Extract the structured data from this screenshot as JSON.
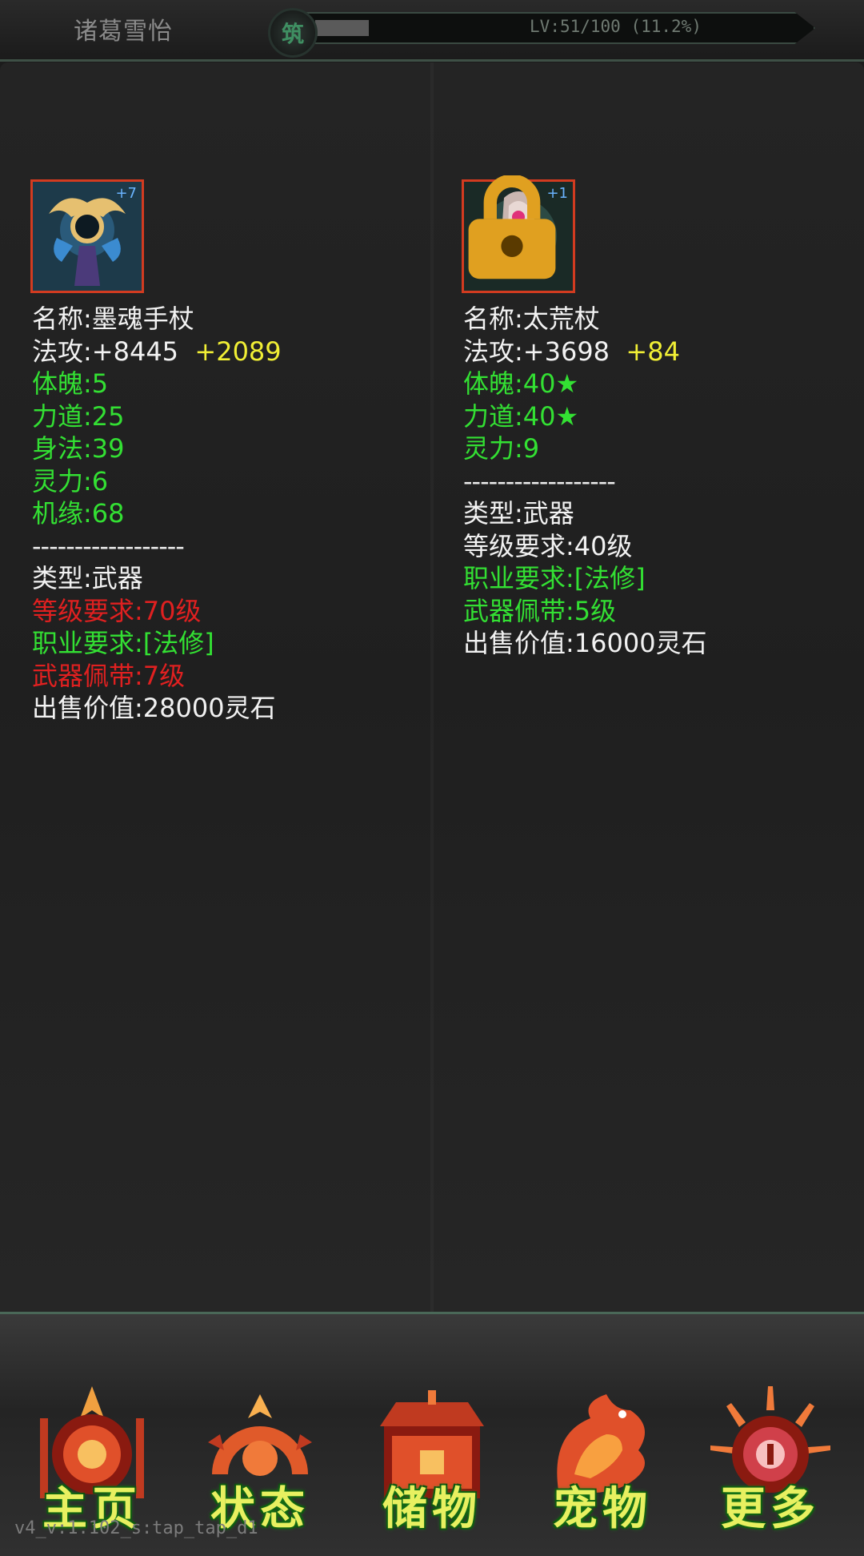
{
  "header": {
    "character_name": "诸葛雪怡",
    "realm_badge": "筑",
    "xp_text": "LV:51/100 (11.2%)",
    "xp_progress": 0.112
  },
  "items": [
    {
      "enhance": "+7",
      "locked": false,
      "name": "名称:墨魂手杖",
      "attack": "法攻:+8445",
      "attack_bonus": "+2089",
      "attributes": [
        "体魄:5",
        "力道:25",
        "身法:39",
        "灵力:6",
        "机缘:68"
      ],
      "divider": "------------------",
      "type": "类型:武器",
      "level_req": "等级要求:70级",
      "class_req": "职业要求:[法修]",
      "weapon_slot": "武器佩带:7级",
      "sell_value": "出售价值:28000灵石"
    },
    {
      "enhance": "+1",
      "locked": true,
      "name": "名称:太荒杖",
      "attack": "法攻:+3698",
      "attack_bonus": "+84",
      "attributes": [
        "体魄:40★",
        "力道:40★",
        "灵力:9"
      ],
      "divider": "------------------",
      "type": "类型:武器",
      "level_req": "等级要求:40级",
      "class_req": "职业要求:[法修]",
      "weapon_slot": "武器佩带:5级",
      "sell_value": "出售价值:16000灵石"
    }
  ],
  "nav": {
    "home": "主页",
    "status": "状态",
    "storage": "储物",
    "pet": "宠物",
    "more": "更多"
  },
  "version": "v4_v:1.102_s:tap_tap_d1",
  "colors": {
    "attribute_green": "#33e033",
    "requirement_red": "#e02020",
    "bonus_yellow": "#f1ef35",
    "icon_border": "#d23b20"
  }
}
